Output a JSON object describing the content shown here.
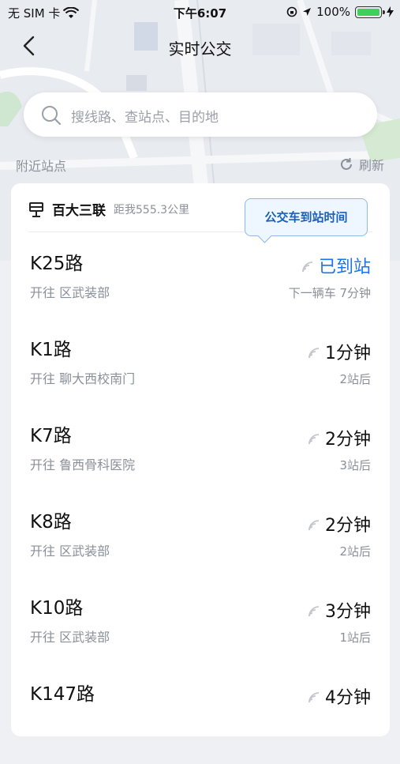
{
  "status_bar": {
    "carrier": "无 SIM 卡",
    "time": "下午6:07",
    "battery": "100%"
  },
  "nav": {
    "title": "实时公交"
  },
  "search": {
    "placeholder": "搜线路、查站点、目的地"
  },
  "nearby": {
    "label": "附近站点",
    "refresh_label": "刷新"
  },
  "station": {
    "name": "百大三联",
    "distance": "距我555.3公里"
  },
  "tooltip": "公交车到站时间",
  "routes": [
    {
      "line": "K25路",
      "dest": "开往 区武装部",
      "eta": "已到站",
      "sub": "下一辆车 7分钟",
      "arrived": true
    },
    {
      "line": "K1路",
      "dest": "开往 聊大西校南门",
      "eta": "1分钟",
      "sub": "2站后",
      "arrived": false
    },
    {
      "line": "K7路",
      "dest": "开往 鲁西骨科医院",
      "eta": "2分钟",
      "sub": "3站后",
      "arrived": false
    },
    {
      "line": "K8路",
      "dest": "开往 区武装部",
      "eta": "2分钟",
      "sub": "2站后",
      "arrived": false
    },
    {
      "line": "K10路",
      "dest": "开往 区武装部",
      "eta": "3分钟",
      "sub": "1站后",
      "arrived": false
    },
    {
      "line": "K147路",
      "dest": "",
      "eta": "4分钟",
      "sub": "",
      "arrived": false
    }
  ],
  "colors": {
    "accent": "#1a73e8",
    "battery": "#3dd15b"
  },
  "icons": {
    "back": "chevron-left-icon",
    "search": "search-icon",
    "refresh": "refresh-icon",
    "bus_stop": "bus-stop-icon",
    "signal": "realtime-signal-icon"
  }
}
